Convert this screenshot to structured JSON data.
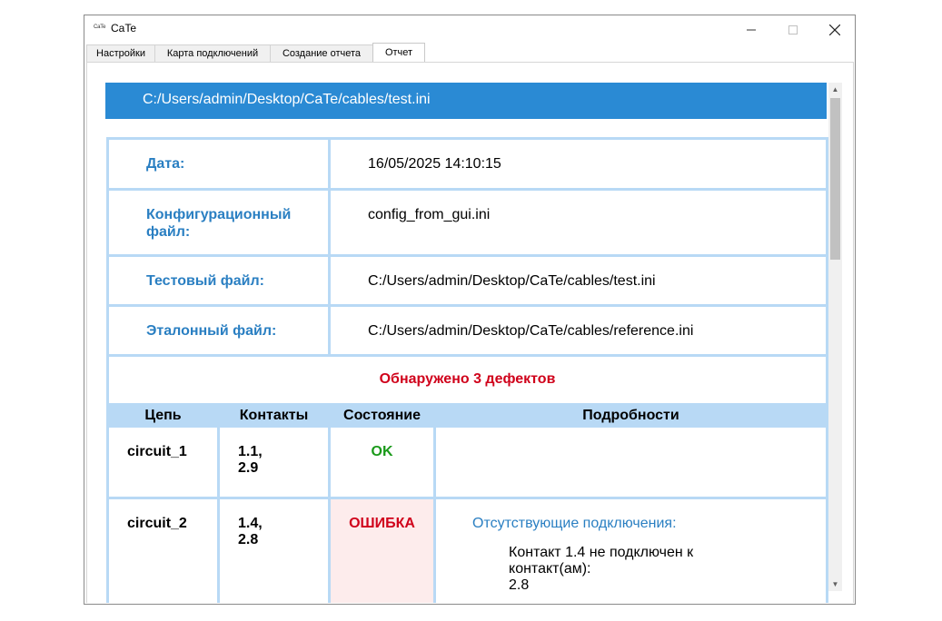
{
  "window": {
    "title": "CaTe",
    "icon_text": "CaTe"
  },
  "tabs": [
    {
      "label": "Настройки",
      "active": false
    },
    {
      "label": "Карта подключений",
      "active": false
    },
    {
      "label": "Создание отчета",
      "active": false
    },
    {
      "label": "Отчет",
      "active": true
    }
  ],
  "report": {
    "path": "C:/Users/admin/Desktop/CaTe/cables/test.ini",
    "info": [
      {
        "label": "Дата:",
        "value": "16/05/2025 14:10:15"
      },
      {
        "label": "Конфигурационный файл:",
        "value": "config_from_gui.ini"
      },
      {
        "label": "Тестовый файл:",
        "value": "C:/Users/admin/Desktop/CaTe/cables/test.ini"
      },
      {
        "label": "Эталонный файл:",
        "value": "C:/Users/admin/Desktop/CaTe/cables/reference.ini"
      }
    ],
    "defects_message": "Обнаружено 3 дефектов",
    "columns": [
      "Цепь",
      "Контакты",
      "Состояние",
      "Подробности"
    ],
    "rows": [
      {
        "circuit": "circuit_1",
        "contacts": "1.1,\n2.9",
        "status": "OK",
        "status_kind": "ok",
        "details_title": "",
        "details_body": ""
      },
      {
        "circuit": "circuit_2",
        "contacts": "1.4,\n2.8",
        "status": "ОШИБКА",
        "status_kind": "error",
        "details_title": "Отсутствующие подключения:",
        "details_body": "Контакт 1.4 не подключен к контакт(ам):\n2.8"
      }
    ]
  },
  "colors": {
    "accent": "#2a8ad4",
    "grid": "#b8d9f5",
    "ok": "#1a9a1a",
    "error": "#d0021b"
  }
}
